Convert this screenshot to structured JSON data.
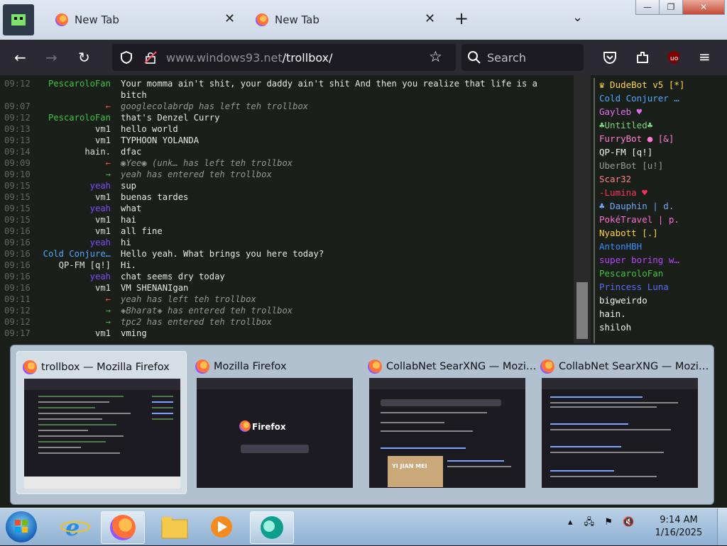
{
  "browser": {
    "tabs": [
      {
        "label": "New Tab"
      },
      {
        "label": "New Tab"
      }
    ],
    "url_host": "www.windows93.net",
    "url_path": "/trollbox/",
    "search_placeholder": "Search"
  },
  "chat": {
    "messages": [
      {
        "time": "09:12",
        "nick": "PescaroloFan",
        "nick_color": "#3fc43f",
        "text": "Your momma ain't shit, your daddy ain't shit And then you realize that life is a",
        "system": false
      },
      {
        "time": "",
        "nick": "",
        "nick_color": "#3fc43f",
        "text": "bitch",
        "system": false
      },
      {
        "time": "09:07",
        "nick": "←",
        "nick_color": "#ff4c4c",
        "text": "googlecolabrdp has left teh trollbox",
        "system": true
      },
      {
        "time": "09:12",
        "nick": "PescaroloFan",
        "nick_color": "#3fc43f",
        "text": "that's Denzel Curry",
        "system": false
      },
      {
        "time": "09:13",
        "nick": "vm1",
        "nick_color": "#e0e0e0",
        "text": "hello world",
        "system": false
      },
      {
        "time": "09:13",
        "nick": "vm1",
        "nick_color": "#e0e0e0",
        "text": "TYPHOON YOLANDA",
        "system": false
      },
      {
        "time": "09:14",
        "nick": "hain.",
        "nick_color": "#e0e0e0",
        "text": "dfac",
        "system": false
      },
      {
        "time": "09:09",
        "nick": "←",
        "nick_color": "#ff4c4c",
        "text": "◉Yee◉ (unk… has left teh trollbox",
        "system": true
      },
      {
        "time": "09:10",
        "nick": "→",
        "nick_color": "#3fc43f",
        "text": "yeah has entered teh trollbox",
        "system": true
      },
      {
        "time": "09:15",
        "nick": "yeah",
        "nick_color": "#7c4dff",
        "text": "sup",
        "system": false
      },
      {
        "time": "09:15",
        "nick": "vm1",
        "nick_color": "#e0e0e0",
        "text": "buenas tardes",
        "system": false
      },
      {
        "time": "09:15",
        "nick": "yeah",
        "nick_color": "#7c4dff",
        "text": "what",
        "system": false
      },
      {
        "time": "09:15",
        "nick": "vm1",
        "nick_color": "#e0e0e0",
        "text": "hai",
        "system": false
      },
      {
        "time": "09:16",
        "nick": "vm1",
        "nick_color": "#e0e0e0",
        "text": "all fine",
        "system": false
      },
      {
        "time": "09:16",
        "nick": "yeah",
        "nick_color": "#7c4dff",
        "text": "hi",
        "system": false
      },
      {
        "time": "09:16",
        "nick": "Cold Conjure…",
        "nick_color": "#4aa8ff",
        "text": "Hello yeah. What brings you here today?",
        "system": false
      },
      {
        "time": "09:16",
        "nick": "QP-FM [q!]",
        "nick_color": "#e0e0e0",
        "text": "Hi.",
        "system": false
      },
      {
        "time": "09:16",
        "nick": "yeah",
        "nick_color": "#7c4dff",
        "text": "chat seems dry today",
        "system": false
      },
      {
        "time": "09:16",
        "nick": "vm1",
        "nick_color": "#e0e0e0",
        "text": "VM SHENANIgan",
        "system": false
      },
      {
        "time": "09:11",
        "nick": "←",
        "nick_color": "#ff4c4c",
        "text": "yeah has left teh trollbox",
        "system": true
      },
      {
        "time": "09:12",
        "nick": "→",
        "nick_color": "#3fc43f",
        "text": "◈Bharat◈ has entered teh trollbox",
        "system": true
      },
      {
        "time": "09:12",
        "nick": "→",
        "nick_color": "#3fc43f",
        "text": "tpc2 has entered teh trollbox",
        "system": true
      },
      {
        "time": "09:17",
        "nick": "vm1",
        "nick_color": "#e0e0e0",
        "text": "vming",
        "system": false
      }
    ]
  },
  "users": [
    {
      "name": "♛ DudeBot v5 [*]",
      "color": "#ffd54a"
    },
    {
      "name": "Cold Conjurer …",
      "color": "#4aa8ff"
    },
    {
      "name": "Gayleb ♥",
      "color": "#e06cf0"
    },
    {
      "name": "♣Untitled♣",
      "color": "#7cd67c"
    },
    {
      "name": "FurryBot ● [&]",
      "color": "#ff7ad0"
    },
    {
      "name": "QP-FM [q!]",
      "color": "#f2f2f2"
    },
    {
      "name": "UberBot [u!]",
      "color": "#9a9a9a"
    },
    {
      "name": "Scar32",
      "color": "#ff8080"
    },
    {
      "name": "-Lumina ♥",
      "color": "#ff3060"
    },
    {
      "name": "♣ Dauphin | d.",
      "color": "#6fa8ff"
    },
    {
      "name": "PokéTravel | p.",
      "color": "#ff6ad5"
    },
    {
      "name": "Nyabott [.]",
      "color": "#ffd23c"
    },
    {
      "name": "AntonHBH",
      "color": "#3a8cff"
    },
    {
      "name": "super boring w…",
      "color": "#c040ff"
    },
    {
      "name": "PescaroloFan",
      "color": "#3fc43f"
    },
    {
      "name": "Princess Luna",
      "color": "#5a6cff"
    },
    {
      "name": "bigweirdo",
      "color": "#f2f2f2"
    },
    {
      "name": "hain.",
      "color": "#f2f2f2"
    },
    {
      "name": "shiloh",
      "color": "#f2f2f2"
    }
  ],
  "previews": [
    {
      "title": "trollbox — Mozilla Firefox",
      "kind": "trollbox",
      "active": true
    },
    {
      "title": "Mozilla Firefox",
      "kind": "newtab",
      "active": false,
      "brand": "Firefox"
    },
    {
      "title": "CollabNet SearXNG — Mozi…",
      "kind": "search",
      "active": false,
      "banner": "YI JIAN MEI"
    },
    {
      "title": "CollabNet SearXNG — Mozi…",
      "kind": "results",
      "active": false
    }
  ],
  "taskbar": {
    "time": "9:14 AM",
    "date": "1/16/2025"
  },
  "colors": {
    "accent_firefox": "#ff7139",
    "chat_bg": "#1a1f1a",
    "taskbar": "#8fb1d3"
  }
}
